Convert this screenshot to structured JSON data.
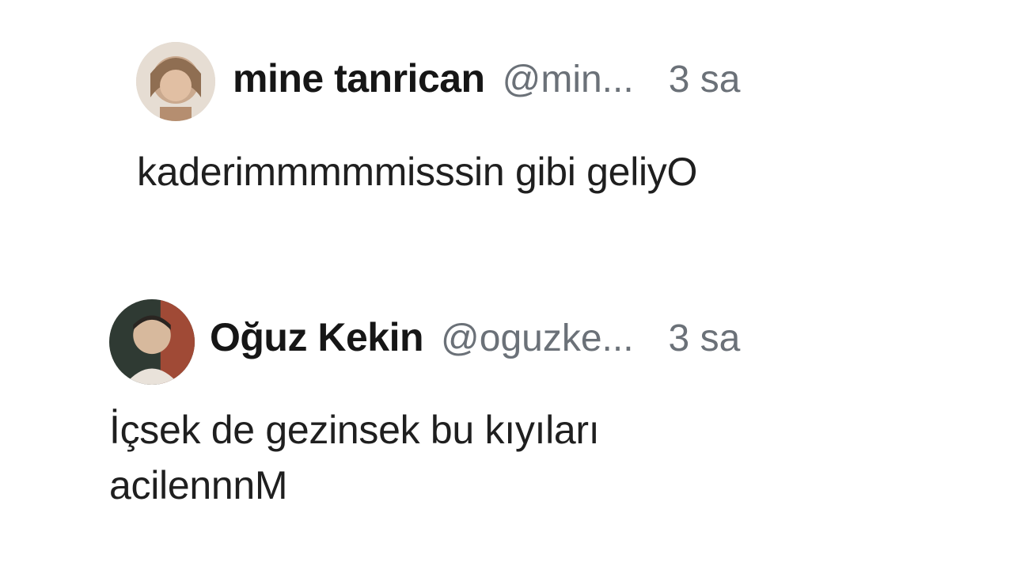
{
  "tweets": [
    {
      "display_name": "mine tanrican",
      "handle": "@min...",
      "time": "3 sa",
      "text": "kaderimmmmmisssin gibi geliyO"
    },
    {
      "display_name": "Oğuz Kekin",
      "handle": "@oguzke...",
      "time": "3 sa",
      "text": "İçsek de gezinsek bu kıyıları\nacilennnM"
    }
  ],
  "colors": {
    "background": "#ffffff",
    "name": "#161616",
    "muted": "#6b7178",
    "body_text": "#1f1f1f"
  }
}
